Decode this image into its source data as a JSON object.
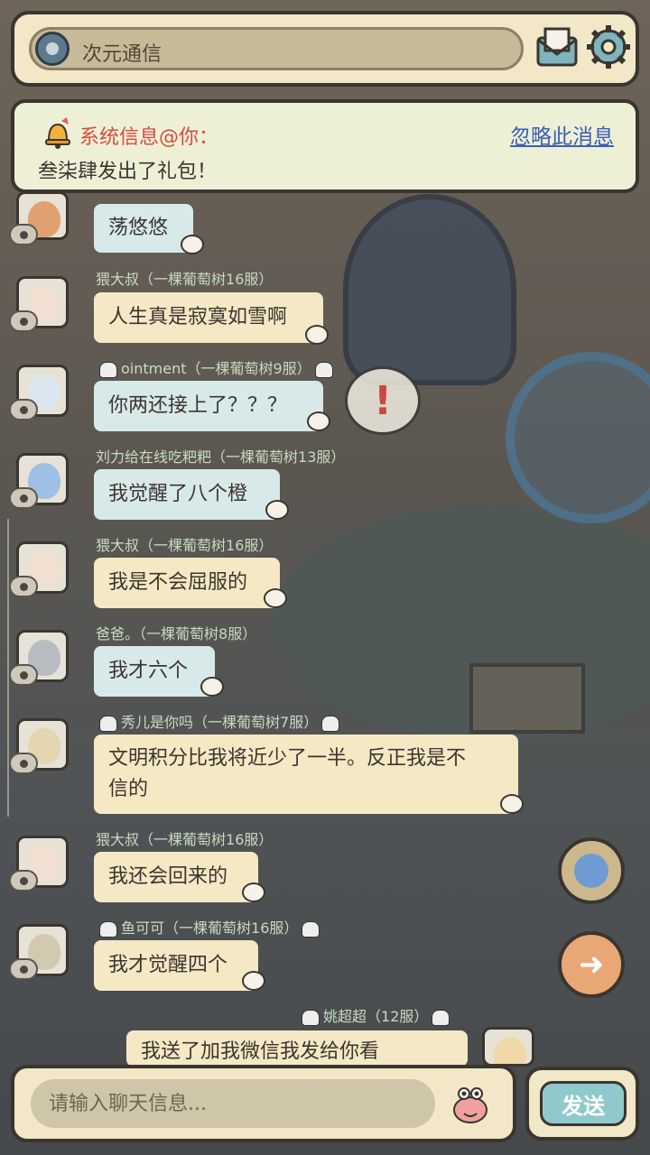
{
  "header": {
    "channel_name": "次元通信"
  },
  "notice": {
    "title": "系统信息@你：",
    "ignore_label": "忽略此消息",
    "message": "叁柒肆发出了礼包！"
  },
  "messages": [
    {
      "sender": "",
      "server": "",
      "text": "荡悠悠"
    },
    {
      "sender": "猥大叔",
      "server": "（一棵葡萄树16服）",
      "text": "人生真是寂寞如雪啊"
    },
    {
      "sender": "ointment",
      "server": "（一棵葡萄树9服）",
      "text": "你两还接上了？？？"
    },
    {
      "sender": "刘力给在线吃粑粑",
      "server": "（一棵葡萄树13服）",
      "text": "我觉醒了八个橙"
    },
    {
      "sender": "猥大叔",
      "server": "（一棵葡萄树16服）",
      "text": "我是不会屈服的"
    },
    {
      "sender": "爸爸。",
      "server": "（一棵葡萄树8服）",
      "text": "我才六个"
    },
    {
      "sender": "秀儿是你吗",
      "server": "（一棵葡萄树7服）",
      "text": "文明积分比我将近少了一半。反正我是不",
      "text2": "信的"
    },
    {
      "sender": "猥大叔",
      "server": "（一棵葡萄树16服）",
      "text": "我还会回来的"
    },
    {
      "sender": "鱼可可",
      "server": "（一棵葡萄树16服）",
      "text": "我才觉醒四个"
    },
    {
      "sender": "姚超超",
      "server": "（12服）",
      "text": "我送了加我微信我发给你看"
    }
  ],
  "input": {
    "placeholder": "请输入聊天信息..."
  },
  "send_label": "发送",
  "colors": {
    "accent": "#f2e7c7",
    "notice_title": "#d84a3f",
    "link": "#3a5fb5"
  }
}
